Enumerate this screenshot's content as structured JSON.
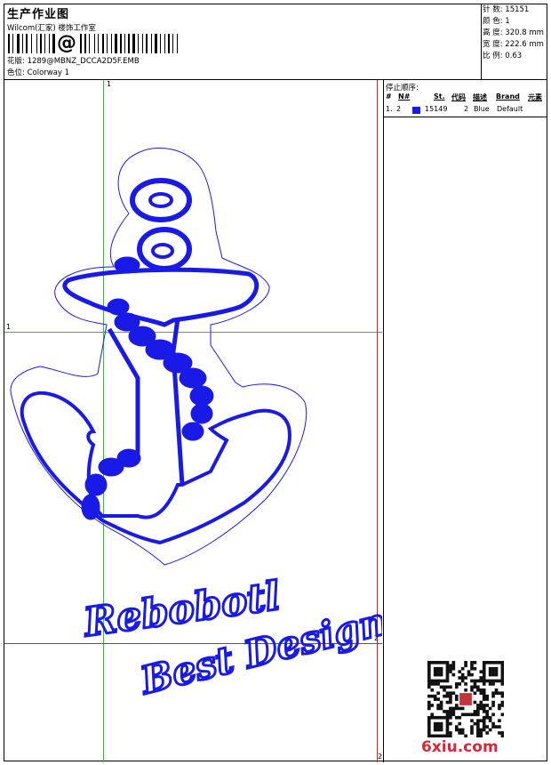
{
  "header": {
    "title": "生产作业图",
    "company": "Wilcom(汇家) 楼饰工作室",
    "barcode_char": "@",
    "design_label": "花版:",
    "design_value": "1289@MBNZ_DCCA2D5F.EMB",
    "colorway_label": "色位:",
    "colorway_value": "Colorway 1"
  },
  "stats": [
    {
      "label": "针 数:",
      "value": "15151"
    },
    {
      "label": "颜 色:",
      "value": "1"
    },
    {
      "label": "高 度:",
      "value": "320.8 mm"
    },
    {
      "label": "宽 度:",
      "value": "222.6 mm"
    },
    {
      "label": "比 例:",
      "value": "0.63"
    }
  ],
  "stop_sequence": {
    "title": "停止顺序:",
    "columns": {
      "num": "#",
      "n": "N#",
      "st": "St.",
      "code": "代码",
      "desc": "描述",
      "brand": "Brand",
      "elem": "元素"
    },
    "rows": [
      {
        "num": "1.",
        "n": "2",
        "st": "15149",
        "code": "2",
        "desc": "Blue",
        "brand": "Default",
        "color": "#1a1ae6"
      }
    ]
  },
  "guides": {
    "v1_label": "1",
    "h1_label": "1",
    "h2_label": "2",
    "v2_label": "2",
    "green": "#22cc22",
    "red": "#e01b24"
  },
  "artwork": {
    "thread_color": "#1a1ae6",
    "text_line1": "Rebobotl",
    "text_line2": "Best Design"
  },
  "watermark": "6xiu.com"
}
